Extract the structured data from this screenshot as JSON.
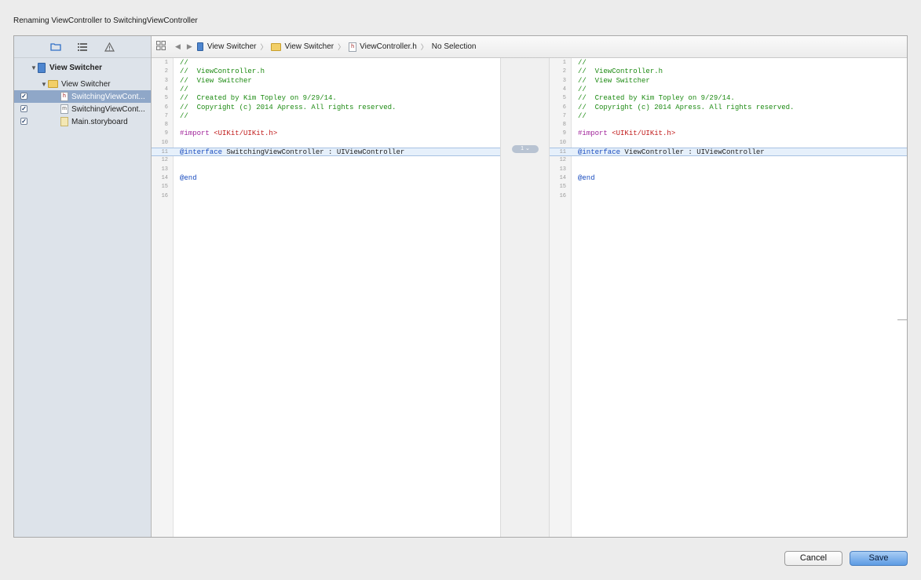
{
  "dialog": {
    "title": "Renaming ViewController to SwitchingViewController",
    "cancel_label": "Cancel",
    "save_label": "Save"
  },
  "sidebar": {
    "tool_icons": [
      "folder-icon",
      "list-icon",
      "warning-icon"
    ],
    "project": "View Switcher",
    "group": "View Switcher",
    "files": [
      {
        "label": "SwitchingViewCont...",
        "type": "h",
        "checked": true,
        "selected": true
      },
      {
        "label": "SwitchingViewCont...",
        "type": "m",
        "checked": true,
        "selected": false
      },
      {
        "label": "Main.storyboard",
        "type": "storyboard",
        "checked": true,
        "selected": false
      }
    ]
  },
  "jumpbar": {
    "items": [
      "View Switcher",
      "View Switcher",
      "ViewController.h",
      "No Selection"
    ]
  },
  "left_pane": {
    "lines": [
      {
        "n": "1",
        "text": "//",
        "kind": "cmt"
      },
      {
        "n": "2",
        "text": "//  ViewController.h",
        "kind": "cmt"
      },
      {
        "n": "3",
        "text": "//  View Switcher",
        "kind": "cmt"
      },
      {
        "n": "4",
        "text": "//",
        "kind": "cmt"
      },
      {
        "n": "5",
        "text": "//  Created by Kim Topley on 9/29/14.",
        "kind": "cmt"
      },
      {
        "n": "6",
        "text": "//  Copyright (c) 2014 Apress. All rights reserved.",
        "kind": "cmt"
      },
      {
        "n": "7",
        "text": "//",
        "kind": "cmt"
      },
      {
        "n": "8",
        "text": "",
        "kind": "plain"
      },
      {
        "n": "9",
        "text": "#import",
        "kind": "import",
        "rest": " <UIKit/UIKit.h>"
      },
      {
        "n": "10",
        "text": "",
        "kind": "plain"
      },
      {
        "n": "11",
        "text": "@interface",
        "kind": "iface",
        "rest": " SwitchingViewController : UIViewController",
        "highlight": true
      },
      {
        "n": "12",
        "text": "",
        "kind": "plain"
      },
      {
        "n": "13",
        "text": "",
        "kind": "plain"
      },
      {
        "n": "14",
        "text": "@end",
        "kind": "at"
      },
      {
        "n": "15",
        "text": "",
        "kind": "plain"
      },
      {
        "n": "16",
        "text": "",
        "kind": "plain"
      }
    ]
  },
  "right_pane": {
    "lines": [
      {
        "n": "1",
        "text": "//",
        "kind": "cmt"
      },
      {
        "n": "2",
        "text": "//  ViewController.h",
        "kind": "cmt"
      },
      {
        "n": "3",
        "text": "//  View Switcher",
        "kind": "cmt"
      },
      {
        "n": "4",
        "text": "//",
        "kind": "cmt"
      },
      {
        "n": "5",
        "text": "//  Created by Kim Topley on 9/29/14.",
        "kind": "cmt"
      },
      {
        "n": "6",
        "text": "//  Copyright (c) 2014 Apress. All rights reserved.",
        "kind": "cmt"
      },
      {
        "n": "7",
        "text": "//",
        "kind": "cmt"
      },
      {
        "n": "8",
        "text": "",
        "kind": "plain"
      },
      {
        "n": "9",
        "text": "#import",
        "kind": "import",
        "rest": " <UIKit/UIKit.h>"
      },
      {
        "n": "10",
        "text": "",
        "kind": "plain"
      },
      {
        "n": "11",
        "text": "@interface",
        "kind": "iface",
        "rest": " ViewController : UIViewController",
        "highlight": true
      },
      {
        "n": "12",
        "text": "",
        "kind": "plain"
      },
      {
        "n": "13",
        "text": "",
        "kind": "plain"
      },
      {
        "n": "14",
        "text": "@end",
        "kind": "at"
      },
      {
        "n": "15",
        "text": "",
        "kind": "plain"
      },
      {
        "n": "16",
        "text": "",
        "kind": "plain"
      }
    ]
  },
  "diff": {
    "change_count": "1"
  },
  "colors": {
    "comment": "#1c8a12",
    "keyword": "#a0249a",
    "string": "#c01a1a",
    "selection": "#8fa7c8",
    "save_button": "#5d9be3"
  }
}
